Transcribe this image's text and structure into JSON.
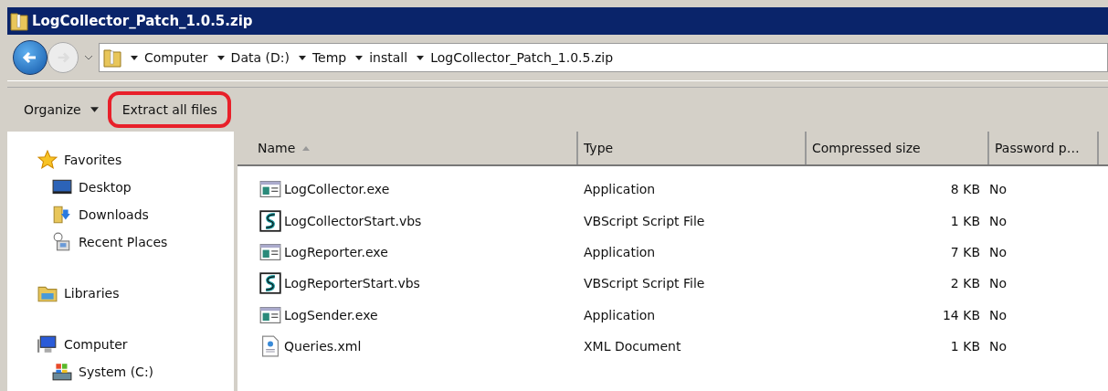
{
  "window": {
    "title": "LogCollector_Patch_1.0.5.zip"
  },
  "address": {
    "crumbs": [
      "Computer",
      "Data (D:)",
      "Temp",
      "install",
      "LogCollector_Patch_1.0.5.zip"
    ]
  },
  "toolbar": [
    {
      "label": "Organize",
      "kind": "menu",
      "highlighted": false
    },
    {
      "label": "Extract all files",
      "kind": "button",
      "highlighted": true
    }
  ],
  "sidebar": {
    "groups": [
      {
        "label": "Favorites",
        "kind": "star",
        "children": [
          {
            "label": "Desktop",
            "kind": "desktop"
          },
          {
            "label": "Downloads",
            "kind": "downloads"
          },
          {
            "label": "Recent Places",
            "kind": "recent"
          }
        ]
      },
      {
        "label": "Libraries",
        "kind": "libraries"
      },
      {
        "label": "Computer",
        "kind": "computer",
        "children": [
          {
            "label": "System (C:)",
            "kind": "drive"
          }
        ]
      }
    ]
  },
  "table": {
    "columns": [
      {
        "label": "Name",
        "sorted": true
      },
      {
        "label": "Type",
        "sorted": false
      },
      {
        "label": "Compressed size",
        "sorted": false
      },
      {
        "label": "Password p…",
        "sorted": false
      }
    ],
    "rows": [
      {
        "name": "LogCollector.exe",
        "kind": "exe",
        "type": "Application",
        "size": "8 KB",
        "password": "No"
      },
      {
        "name": "LogCollectorStart.vbs",
        "kind": "vbs",
        "type": "VBScript Script File",
        "size": "1 KB",
        "password": "No"
      },
      {
        "name": "LogReporter.exe",
        "kind": "exe",
        "type": "Application",
        "size": "7 KB",
        "password": "No"
      },
      {
        "name": "LogReporterStart.vbs",
        "kind": "vbs",
        "type": "VBScript Script File",
        "size": "2 KB",
        "password": "No"
      },
      {
        "name": "LogSender.exe",
        "kind": "exe",
        "type": "Application",
        "size": "14 KB",
        "password": "No"
      },
      {
        "name": "Queries.xml",
        "kind": "xml",
        "type": "XML Document",
        "size": "1 KB",
        "password": "No"
      }
    ]
  }
}
